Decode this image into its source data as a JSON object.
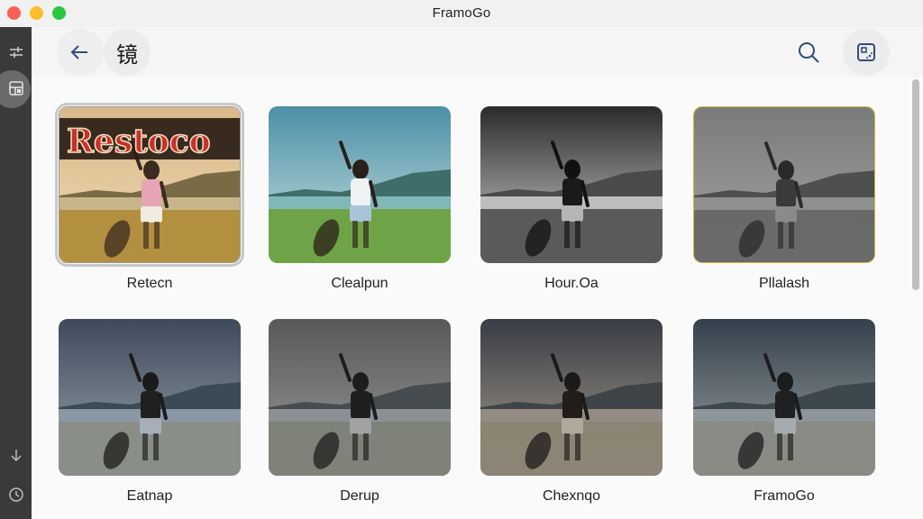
{
  "window": {
    "title": "FramoGo"
  },
  "header": {
    "back_icon": "arrow-left-icon",
    "glyph": "镜",
    "search_icon": "search-icon",
    "gallery_icon": "gallery-icon"
  },
  "sidebar": {
    "items": [
      {
        "icon": "sliders-icon"
      },
      {
        "icon": "layout-icon",
        "active": true
      },
      {
        "icon": "arrow-down-icon"
      },
      {
        "icon": "clock-icon"
      }
    ]
  },
  "filters": [
    {
      "label": "Retecn",
      "style": "retro",
      "overlay_text": "Restoco",
      "selected": true
    },
    {
      "label": "Clealpun",
      "style": "color"
    },
    {
      "label": "Hour.Oa",
      "style": "bw"
    },
    {
      "label": "Pllalash",
      "style": "mono",
      "highlighted": true
    },
    {
      "label": "Eatnap",
      "style": "dark"
    },
    {
      "label": "Derup",
      "style": "fade"
    },
    {
      "label": "Chexnqo",
      "style": "warmdark"
    },
    {
      "label": "FramoGo",
      "style": "cool"
    }
  ],
  "colors": {
    "sidebar": "#3a3a3a",
    "accent_icon": "#2f4d7a",
    "highlight_border": "#d4b640"
  }
}
